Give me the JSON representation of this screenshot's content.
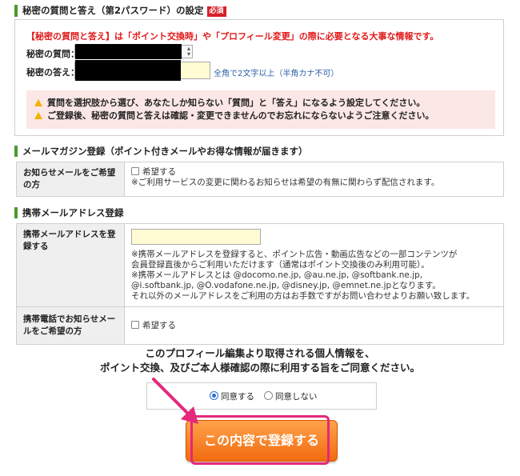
{
  "secret": {
    "title": "秘密の質問と答え（第2パスワード）の設定",
    "required_badge": "必須",
    "notice": "【秘密の質問と答え】は「ポイント交換時」や「プロフィール変更」の際に必要となる大事な情報です。",
    "question_label": "秘密の質問：",
    "answer_label": "秘密の答え：",
    "answer_hint": "全角で2文字以上（半角カナ不可）",
    "caution_1": "質問を選択肢から選び、あなたしか知らない「質問」と「答え」になるよう設定してください。",
    "caution_2": "ご登録後、秘密の質問と答えは確認・変更できませんのでお忘れにならないようご注意ください。"
  },
  "mailmag": {
    "title": "メールマガジン登録（ポイント付きメールやお得な情報が届きます）",
    "row_label": "お知らせメールをご希望の方",
    "checkbox_label": "希望する",
    "note": "※ご利用サービスの変更に関わるお知らせは希望の有無に関わらず配信されます。"
  },
  "mobile": {
    "title": "携帯メールアドレス登録",
    "address_label": "携帯メールアドレスを登録する",
    "note_1": "※携帯メールアドレスを登録すると、ポイント広告・動画広告などの一部コンテンツが",
    "note_2": "会員登録直後からご利用いただけます（通常はポイント交換後のみ利用可能）。",
    "note_3": "※携帯メールアドレスとは @docomo.ne.jp, @au.ne.jp, @softbank.ne.jp,",
    "note_4": "@i.softbank.jp, @O.vodafone.ne.jp, @disney.jp, @emnet.ne.jpとなります。",
    "note_5": "それ以外のメールアドレスをご利用の方はお手数ですがお問い合わせよりお願い致します。",
    "phone_label": "携帯電話でお知らせメールをご希望の方",
    "checkbox_label": "希望する"
  },
  "consent": {
    "line_1": "このプロフィール編集より取得される個人情報を、",
    "line_2": "ポイント交換、及びご本人様確認の際に利用する旨をご同意ください。",
    "agree": "同意する",
    "disagree": "同意しない",
    "agree_selected": true
  },
  "submit_label": "この内容で登録する",
  "colors": {
    "accent_green": "#4a9a2c",
    "warning_red": "#e21a1a",
    "submit_orange": "#f26b10",
    "highlight_pink": "#e4287b"
  }
}
